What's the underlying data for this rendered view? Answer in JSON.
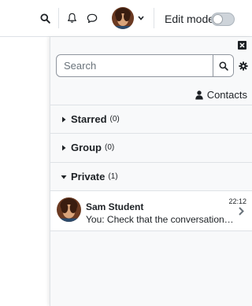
{
  "navbar": {
    "edit_mode_label": "Edit mode",
    "edit_mode_on": false
  },
  "drawer": {
    "search_placeholder": "Search",
    "contacts_label": "Contacts",
    "sections": [
      {
        "label": "Starred",
        "count": "(0)",
        "expanded": false
      },
      {
        "label": "Group",
        "count": "(0)",
        "expanded": false
      },
      {
        "label": "Private",
        "count": "(1)",
        "expanded": true
      }
    ],
    "conversation": {
      "name": "Sam Student",
      "time": "22:12",
      "preview": "You: Check that the conversation is still visible"
    }
  },
  "icons": {
    "search": "search-icon",
    "bell": "bell-icon",
    "chat": "chat-bubble-icon",
    "chevron": "chevron-down-icon",
    "close": "close-icon",
    "gear": "gear-icon",
    "contacts": "user-icon"
  },
  "colors": {
    "text": "#1d2125",
    "border": "#dee2e6",
    "drawer_bg": "#f8f9fa"
  }
}
